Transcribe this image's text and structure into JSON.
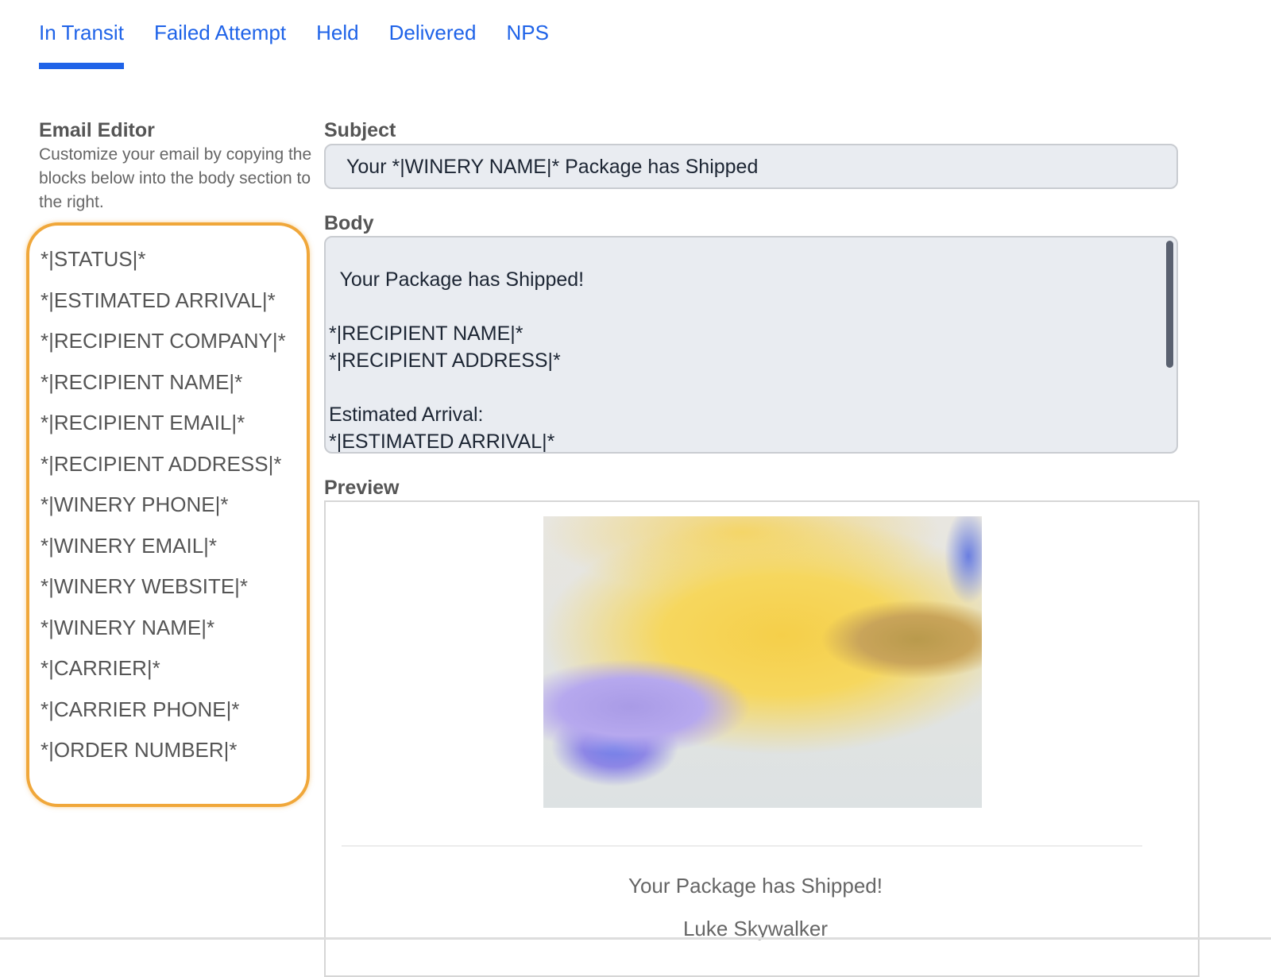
{
  "tabs": [
    {
      "label": "In Transit",
      "active": true
    },
    {
      "label": "Failed Attempt"
    },
    {
      "label": "Held"
    },
    {
      "label": "Delivered"
    },
    {
      "label": "NPS"
    }
  ],
  "accent_color": "#1f63e8",
  "editor": {
    "title": "Email Editor",
    "description": "Customize your email by copying the blocks below into the body section to the right.",
    "blocks": [
      "*|STATUS|*",
      "*|ESTIMATED ARRIVAL|*",
      "*|RECIPIENT COMPANY|*",
      "*|RECIPIENT NAME|*",
      "*|RECIPIENT EMAIL|*",
      "*|RECIPIENT ADDRESS|*",
      "*|WINERY PHONE|*",
      "*|WINERY EMAIL|*",
      "*|WINERY WEBSITE|*",
      "*|WINERY NAME|*",
      "*|CARRIER|*",
      "*|CARRIER PHONE|*",
      "*|ORDER NUMBER|*"
    ]
  },
  "subject": {
    "label": "Subject",
    "value": "Your *|WINERY NAME|* Package has Shipped"
  },
  "body": {
    "label": "Body",
    "value": "Your Package has Shipped!\n\n*|RECIPIENT NAME|*\n*|RECIPIENT ADDRESS|*\n\nEstimated Arrival:\n*|ESTIMATED ARRIVAL|*\n*|RECIPIENT COMPANY|*"
  },
  "preview": {
    "label": "Preview",
    "heading": "Your Package has Shipped!",
    "recipient": "Luke Skywalker"
  }
}
